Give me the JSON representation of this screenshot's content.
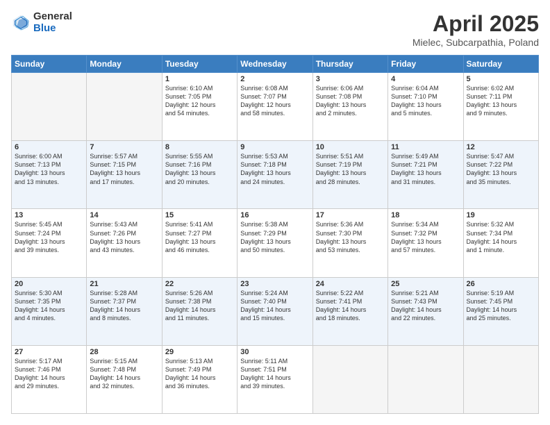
{
  "header": {
    "logo_general": "General",
    "logo_blue": "Blue",
    "title": "April 2025",
    "subtitle": "Mielec, Subcarpathia, Poland"
  },
  "days_of_week": [
    "Sunday",
    "Monday",
    "Tuesday",
    "Wednesday",
    "Thursday",
    "Friday",
    "Saturday"
  ],
  "weeks": [
    [
      {
        "day": "",
        "info": ""
      },
      {
        "day": "",
        "info": ""
      },
      {
        "day": "1",
        "info": "Sunrise: 6:10 AM\nSunset: 7:05 PM\nDaylight: 12 hours\nand 54 minutes."
      },
      {
        "day": "2",
        "info": "Sunrise: 6:08 AM\nSunset: 7:07 PM\nDaylight: 12 hours\nand 58 minutes."
      },
      {
        "day": "3",
        "info": "Sunrise: 6:06 AM\nSunset: 7:08 PM\nDaylight: 13 hours\nand 2 minutes."
      },
      {
        "day": "4",
        "info": "Sunrise: 6:04 AM\nSunset: 7:10 PM\nDaylight: 13 hours\nand 5 minutes."
      },
      {
        "day": "5",
        "info": "Sunrise: 6:02 AM\nSunset: 7:11 PM\nDaylight: 13 hours\nand 9 minutes."
      }
    ],
    [
      {
        "day": "6",
        "info": "Sunrise: 6:00 AM\nSunset: 7:13 PM\nDaylight: 13 hours\nand 13 minutes."
      },
      {
        "day": "7",
        "info": "Sunrise: 5:57 AM\nSunset: 7:15 PM\nDaylight: 13 hours\nand 17 minutes."
      },
      {
        "day": "8",
        "info": "Sunrise: 5:55 AM\nSunset: 7:16 PM\nDaylight: 13 hours\nand 20 minutes."
      },
      {
        "day": "9",
        "info": "Sunrise: 5:53 AM\nSunset: 7:18 PM\nDaylight: 13 hours\nand 24 minutes."
      },
      {
        "day": "10",
        "info": "Sunrise: 5:51 AM\nSunset: 7:19 PM\nDaylight: 13 hours\nand 28 minutes."
      },
      {
        "day": "11",
        "info": "Sunrise: 5:49 AM\nSunset: 7:21 PM\nDaylight: 13 hours\nand 31 minutes."
      },
      {
        "day": "12",
        "info": "Sunrise: 5:47 AM\nSunset: 7:22 PM\nDaylight: 13 hours\nand 35 minutes."
      }
    ],
    [
      {
        "day": "13",
        "info": "Sunrise: 5:45 AM\nSunset: 7:24 PM\nDaylight: 13 hours\nand 39 minutes."
      },
      {
        "day": "14",
        "info": "Sunrise: 5:43 AM\nSunset: 7:26 PM\nDaylight: 13 hours\nand 43 minutes."
      },
      {
        "day": "15",
        "info": "Sunrise: 5:41 AM\nSunset: 7:27 PM\nDaylight: 13 hours\nand 46 minutes."
      },
      {
        "day": "16",
        "info": "Sunrise: 5:38 AM\nSunset: 7:29 PM\nDaylight: 13 hours\nand 50 minutes."
      },
      {
        "day": "17",
        "info": "Sunrise: 5:36 AM\nSunset: 7:30 PM\nDaylight: 13 hours\nand 53 minutes."
      },
      {
        "day": "18",
        "info": "Sunrise: 5:34 AM\nSunset: 7:32 PM\nDaylight: 13 hours\nand 57 minutes."
      },
      {
        "day": "19",
        "info": "Sunrise: 5:32 AM\nSunset: 7:34 PM\nDaylight: 14 hours\nand 1 minute."
      }
    ],
    [
      {
        "day": "20",
        "info": "Sunrise: 5:30 AM\nSunset: 7:35 PM\nDaylight: 14 hours\nand 4 minutes."
      },
      {
        "day": "21",
        "info": "Sunrise: 5:28 AM\nSunset: 7:37 PM\nDaylight: 14 hours\nand 8 minutes."
      },
      {
        "day": "22",
        "info": "Sunrise: 5:26 AM\nSunset: 7:38 PM\nDaylight: 14 hours\nand 11 minutes."
      },
      {
        "day": "23",
        "info": "Sunrise: 5:24 AM\nSunset: 7:40 PM\nDaylight: 14 hours\nand 15 minutes."
      },
      {
        "day": "24",
        "info": "Sunrise: 5:22 AM\nSunset: 7:41 PM\nDaylight: 14 hours\nand 18 minutes."
      },
      {
        "day": "25",
        "info": "Sunrise: 5:21 AM\nSunset: 7:43 PM\nDaylight: 14 hours\nand 22 minutes."
      },
      {
        "day": "26",
        "info": "Sunrise: 5:19 AM\nSunset: 7:45 PM\nDaylight: 14 hours\nand 25 minutes."
      }
    ],
    [
      {
        "day": "27",
        "info": "Sunrise: 5:17 AM\nSunset: 7:46 PM\nDaylight: 14 hours\nand 29 minutes."
      },
      {
        "day": "28",
        "info": "Sunrise: 5:15 AM\nSunset: 7:48 PM\nDaylight: 14 hours\nand 32 minutes."
      },
      {
        "day": "29",
        "info": "Sunrise: 5:13 AM\nSunset: 7:49 PM\nDaylight: 14 hours\nand 36 minutes."
      },
      {
        "day": "30",
        "info": "Sunrise: 5:11 AM\nSunset: 7:51 PM\nDaylight: 14 hours\nand 39 minutes."
      },
      {
        "day": "",
        "info": ""
      },
      {
        "day": "",
        "info": ""
      },
      {
        "day": "",
        "info": ""
      }
    ]
  ]
}
